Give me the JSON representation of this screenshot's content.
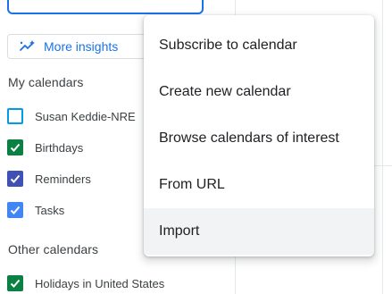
{
  "sidebar": {
    "insights_button": {
      "label": "More insights",
      "icon": "insights-sparkle-icon"
    },
    "my_calendars": {
      "title": "My calendars",
      "items": [
        {
          "label": "Susan Keddie-NRE",
          "checked": false,
          "color": "#039be5"
        },
        {
          "label": "Birthdays",
          "checked": true,
          "color": "#0b8043"
        },
        {
          "label": "Reminders",
          "checked": true,
          "color": "#3f51b5"
        },
        {
          "label": "Tasks",
          "checked": true,
          "color": "#4285f4"
        }
      ]
    },
    "other_calendars": {
      "title": "Other calendars",
      "items": [
        {
          "label": "Holidays in United States",
          "checked": true,
          "color": "#0b8043"
        }
      ]
    }
  },
  "menu": {
    "items": [
      {
        "label": "Subscribe to calendar"
      },
      {
        "label": "Create new calendar"
      },
      {
        "label": "Browse calendars of interest"
      },
      {
        "label": "From URL"
      },
      {
        "label": "Import",
        "highlighted": true
      }
    ]
  },
  "colors": {
    "accent": "#1a73e8",
    "menu_hover": "#f1f3f4"
  }
}
